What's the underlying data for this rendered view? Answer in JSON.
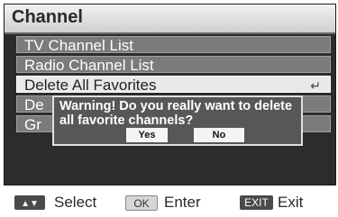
{
  "title": "Channel",
  "menu": {
    "items": [
      {
        "label": "TV Channel List"
      },
      {
        "label": "Radio Channel List"
      },
      {
        "label": "Delete All Favorites"
      },
      {
        "label": "De"
      },
      {
        "label": "Gr"
      }
    ],
    "selected_index": 2,
    "enter_icon": "enter-return-icon"
  },
  "dialog": {
    "message": "Warning! Do you really want to delete all favorite channels?",
    "yes_label": "Yes",
    "no_label": "No"
  },
  "footer": {
    "arrow_key_icon": "up-down-arrow-key-icon",
    "select_label": "Select",
    "ok_key": "OK",
    "enter_label": "Enter",
    "exit_key": "EXIT",
    "exit_label": "Exit"
  },
  "colors": {
    "screen_bg": "#2c2c2c",
    "menu_item_bg": "#7b7b7b",
    "selected_bg": "#e9e9e9",
    "dialog_bg": "#575757"
  }
}
